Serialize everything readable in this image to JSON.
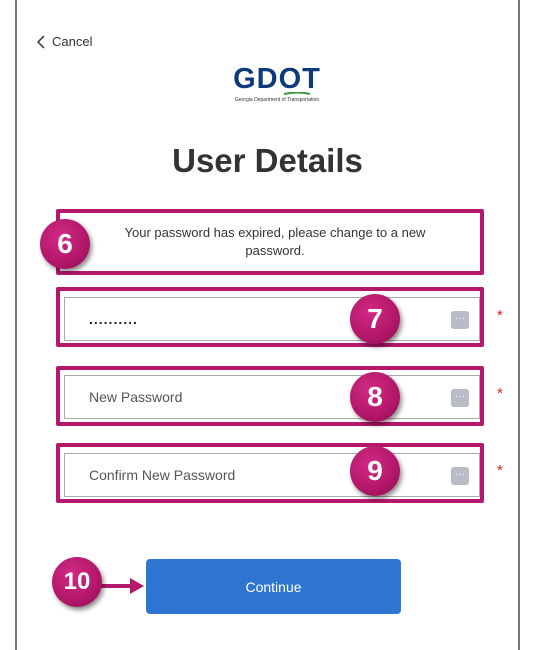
{
  "cancel_label": "Cancel",
  "logo": {
    "word": "GDOT",
    "subtitle": "Georgia Department of Transportation"
  },
  "title": "User Details",
  "message": "Your password has expired, please change to a new password.",
  "fields": {
    "current_password": {
      "value": "..........",
      "required_mark": "*"
    },
    "new_password": {
      "placeholder": "New Password",
      "required_mark": "*"
    },
    "confirm_password": {
      "placeholder": "Confirm New Password",
      "required_mark": "*"
    }
  },
  "continue_label": "Continue",
  "badges": {
    "b6": "6",
    "b7": "7",
    "b8": "8",
    "b9": "9",
    "b10": "10"
  },
  "colors": {
    "accent_magenta": "#b5186b",
    "button_blue": "#2f76d2",
    "logo_blue": "#0d3a7a"
  },
  "icons": {
    "back": "chevron-left-icon",
    "reveal": "password-reveal-icon"
  }
}
